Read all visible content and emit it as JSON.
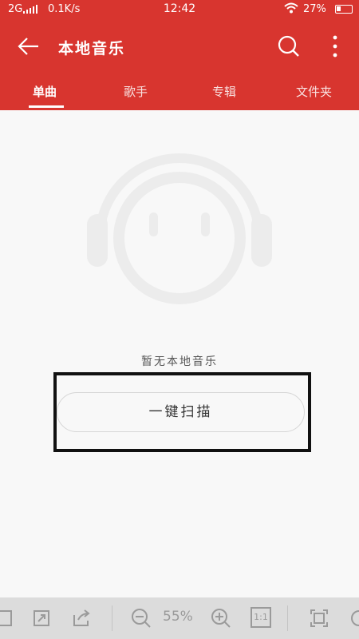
{
  "status_bar": {
    "signal": "2G",
    "speed": "0.1K/s",
    "time": "12:42",
    "battery": "27%"
  },
  "toolbar": {
    "title": "本地音乐",
    "icons": [
      "back-arrow-icon",
      "search-icon",
      "more-vert-icon"
    ]
  },
  "tabs": [
    {
      "label": "单曲",
      "active": true
    },
    {
      "label": "歌手",
      "active": false
    },
    {
      "label": "专辑",
      "active": false
    },
    {
      "label": "文件夹",
      "active": false
    }
  ],
  "empty_state": {
    "message": "暂无本地音乐",
    "scan_button": "一键扫描"
  },
  "bottom_toolbar": {
    "zoom": "55%",
    "ratio_label": "1:1",
    "icons": [
      "page-icon",
      "crop-icon",
      "share-icon",
      "zoom-out-icon",
      "zoom-in-icon",
      "actual-size-icon",
      "fit-icon"
    ]
  },
  "colors": {
    "header_red": "#d8352f",
    "background": "#f8f8f8",
    "illustration": "#ececec"
  }
}
